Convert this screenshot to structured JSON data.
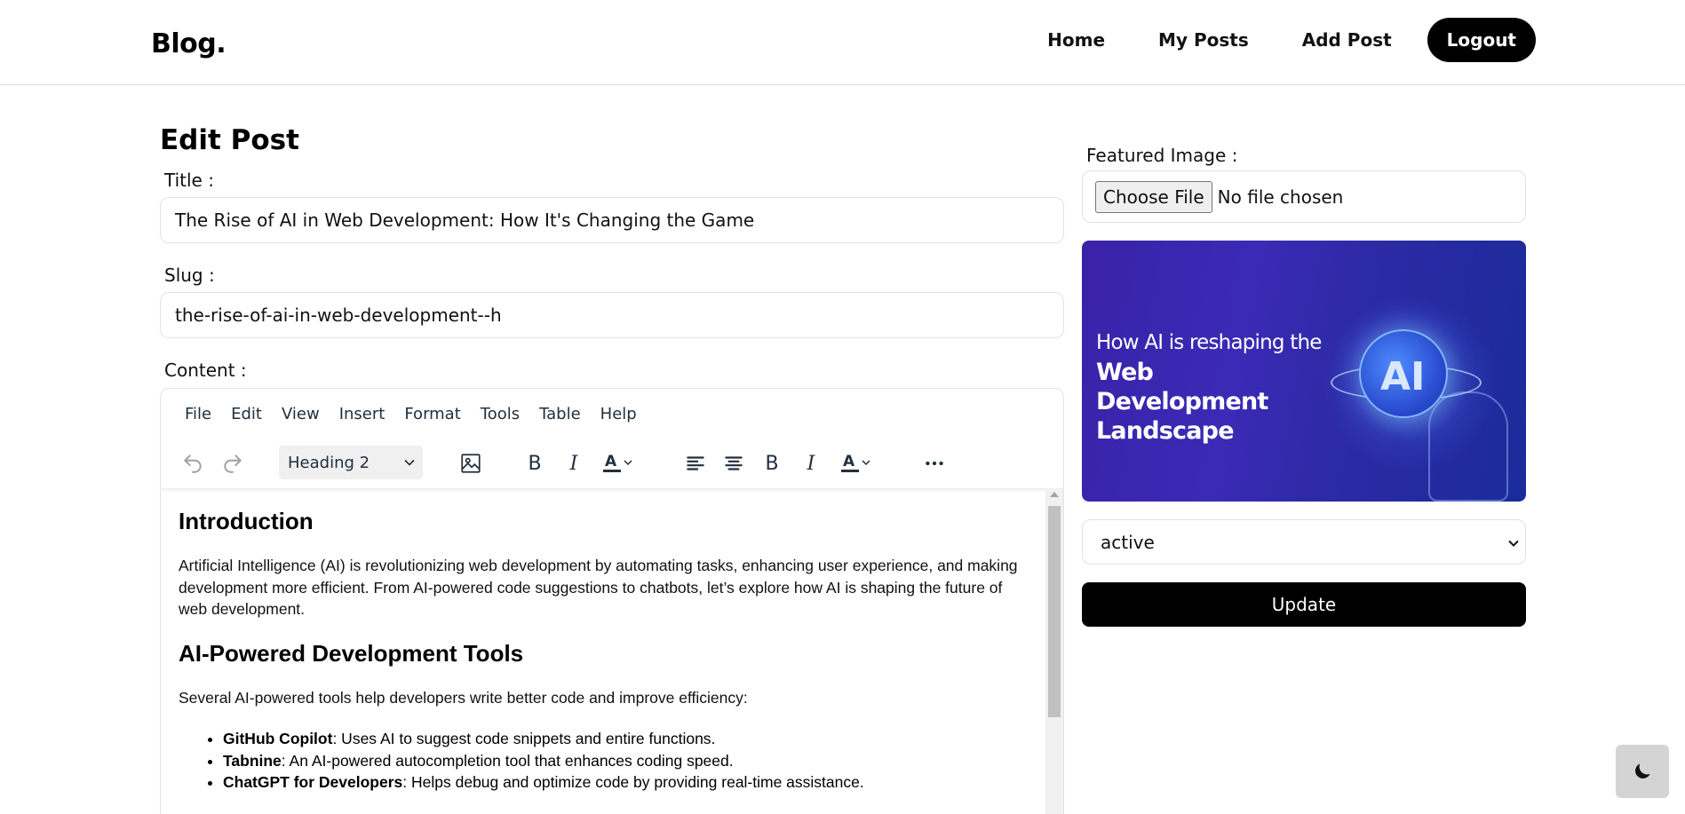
{
  "header": {
    "logo": "Blog.",
    "nav": [
      "Home",
      "My Posts",
      "Add Post"
    ],
    "logout": "Logout"
  },
  "form": {
    "page_title": "Edit Post",
    "title_label": "Title :",
    "title_value": "The Rise of AI in Web Development: How It's Changing the Game",
    "slug_label": "Slug :",
    "slug_value": "the-rise-of-ai-in-web-development--h",
    "content_label": "Content :"
  },
  "editor": {
    "menu": [
      "File",
      "Edit",
      "View",
      "Insert",
      "Format",
      "Tools",
      "Table",
      "Help"
    ],
    "block_format": "Heading 2",
    "toolbar_icons": [
      "undo-icon",
      "redo-icon",
      "image-icon",
      "bold-icon",
      "italic-icon",
      "text-color-icon",
      "align-left-icon",
      "align-center-icon",
      "more-icon"
    ],
    "bold_glyph": "B",
    "italic_glyph": "I",
    "color_glyph": "A",
    "heading1": "Introduction",
    "para1": "Artificial Intelligence (AI) is revolutionizing web development by automating tasks, enhancing user experience, and making development more efficient. From AI-powered code suggestions to chatbots, let’s explore how AI is shaping the future of web development.",
    "heading2": "AI-Powered Development Tools",
    "para2": "Several AI-powered tools help developers write better code and improve efficiency:",
    "list": [
      {
        "name": "GitHub Copilot",
        "desc": ": Uses AI to suggest code snippets and entire functions."
      },
      {
        "name": "Tabnine",
        "desc": ": An AI-powered autocompletion tool that enhances coding speed."
      },
      {
        "name": "ChatGPT for Developers",
        "desc": ": Helps debug and optimize code by providing real-time assistance."
      }
    ]
  },
  "sidebar": {
    "featured_label": "Featured Image :",
    "file_button": "Choose File",
    "file_status": "No file chosen",
    "image": {
      "line1": "How AI is reshaping the",
      "line2": "Web Development Landscape",
      "badge": "AI"
    },
    "status_value": "active",
    "update_button": "Update"
  },
  "theme": {
    "toggle_icon": "moon-icon"
  }
}
